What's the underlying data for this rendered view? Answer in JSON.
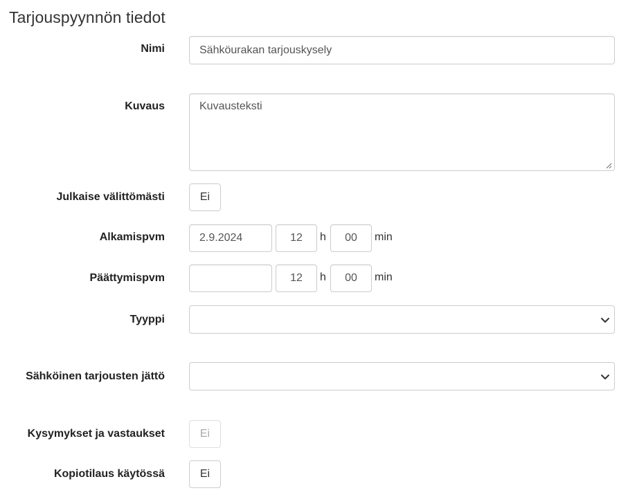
{
  "form": {
    "title": "Tarjouspyynnön tiedot",
    "name": {
      "label": "Nimi",
      "value": "Sähköurakan tarjouskysely"
    },
    "description": {
      "label": "Kuvaus",
      "value": "Kuvausteksti"
    },
    "publish_now": {
      "label": "Julkaise välittömästi",
      "value": "Ei"
    },
    "start_date": {
      "label": "Alkamispvm",
      "date": "2.9.2024",
      "hour": "12",
      "hour_unit": "h",
      "minute": "00",
      "minute_unit": "min"
    },
    "end_date": {
      "label": "Päättymispvm",
      "date": "",
      "hour": "12",
      "hour_unit": "h",
      "minute": "00",
      "minute_unit": "min"
    },
    "type": {
      "label": "Tyyppi",
      "value": ""
    },
    "electronic_bidding": {
      "label": "Sähköinen tarjousten jättö",
      "value": ""
    },
    "qa": {
      "label": "Kysymykset ja vastaukset",
      "value": "Ei",
      "disabled": true
    },
    "copy_order": {
      "label": "Kopiotilaus käytössä",
      "value": "Ei"
    }
  },
  "icons": {
    "select_arrow": "chevron-down-icon",
    "resize": "resize-grip-icon"
  }
}
